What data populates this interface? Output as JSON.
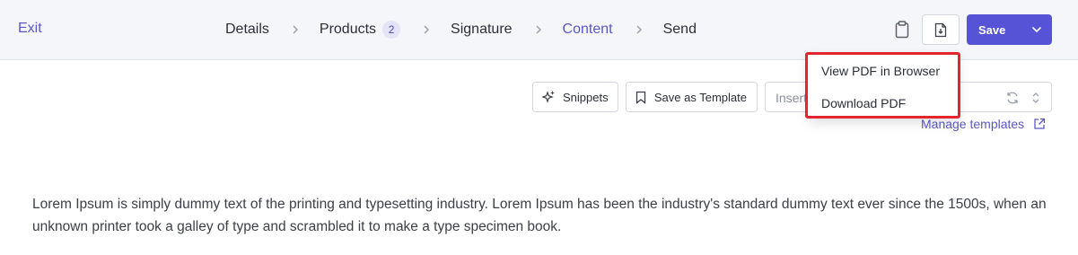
{
  "header": {
    "exit_label": "Exit",
    "steps": [
      {
        "label": "Details",
        "active": false
      },
      {
        "label": "Products",
        "badge": "2",
        "active": false
      },
      {
        "label": "Signature",
        "active": false
      },
      {
        "label": "Content",
        "active": true
      },
      {
        "label": "Send",
        "active": false
      }
    ],
    "save_label": "Save",
    "clipboard_icon": "clipboard-icon",
    "pdf_icon": "pdf-file-icon"
  },
  "pdf_menu": {
    "items": [
      "View PDF in Browser",
      "Download PDF"
    ]
  },
  "toolbar": {
    "snippets_label": "Snippets",
    "save_template_label": "Save as Template",
    "insert_placeholder": "Insert template",
    "manage_templates_label": "Manage templates"
  },
  "content": {
    "paragraph": "Lorem Ipsum is simply dummy text of the printing and typesetting industry. Lorem Ipsum has been the industry's standard dummy text ever since the 1500s, when an unknown printer took a galley of type and scrambled it to make a type specimen book."
  },
  "colors": {
    "accent": "#5653d6",
    "highlight": "#e3262d",
    "header_bg": "#f5f6fa"
  }
}
